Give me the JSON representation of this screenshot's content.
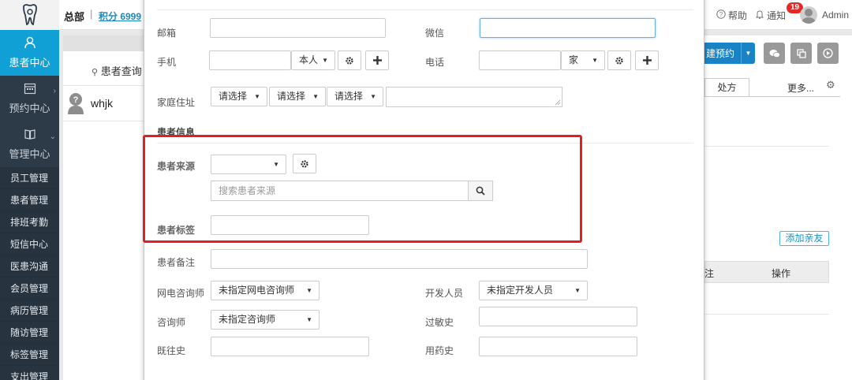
{
  "sidebar": {
    "nav": [
      {
        "label": "患者中心",
        "icon": "person-icon",
        "active": true
      },
      {
        "label": "预约中心",
        "icon": "calendar-icon",
        "active": false
      },
      {
        "label": "管理中心",
        "icon": "book-icon",
        "active": false
      }
    ],
    "sub_items": [
      "员工管理",
      "患者管理",
      "排班考勤",
      "短信中心",
      "医患沟通",
      "会员管理",
      "病历管理",
      "随访管理",
      "标签管理",
      "支出管理"
    ]
  },
  "topbar": {
    "org": "总部",
    "separator": "|",
    "points": "积分 6999",
    "help": "帮助",
    "notify": "通知",
    "notify_count": "19",
    "user": "Admin"
  },
  "background": {
    "patient_query": "患者查询",
    "patient_name": "whjk",
    "booking_button": "建预约",
    "tab_prescription": "处方",
    "more": "更多...",
    "add_relative": "添加亲友",
    "col_partial": "注",
    "col_ops": "操作"
  },
  "modal": {
    "email_label": "邮箱",
    "wechat_label": "微信",
    "mobile_label": "手机",
    "mobile_owner": "本人",
    "phone_label": "电话",
    "phone_type": "家",
    "address_label": "家庭住址",
    "address_select_1": "请选择",
    "address_select_2": "请选择",
    "address_select_3": "请选择",
    "section_patient_info": "患者信息",
    "source_label": "患者来源",
    "source_search_placeholder": "搜索患者来源",
    "tag_label": "患者标签",
    "remark_label": "患者备注",
    "online_consultant_label": "网电咨询师",
    "online_consultant_value": "未指定网电咨询师",
    "developer_label": "开发人员",
    "developer_value": "未指定开发人员",
    "consultant_label": "咨询师",
    "consultant_value": "未指定咨询师",
    "allergy_label": "过敏史",
    "history_label": "既往史",
    "medication_label": "用药史"
  },
  "colors": {
    "sidebar_bg": "#2d3a47",
    "accent": "#11a0d6",
    "highlight_border": "#e02020",
    "badge": "#e02b27"
  }
}
